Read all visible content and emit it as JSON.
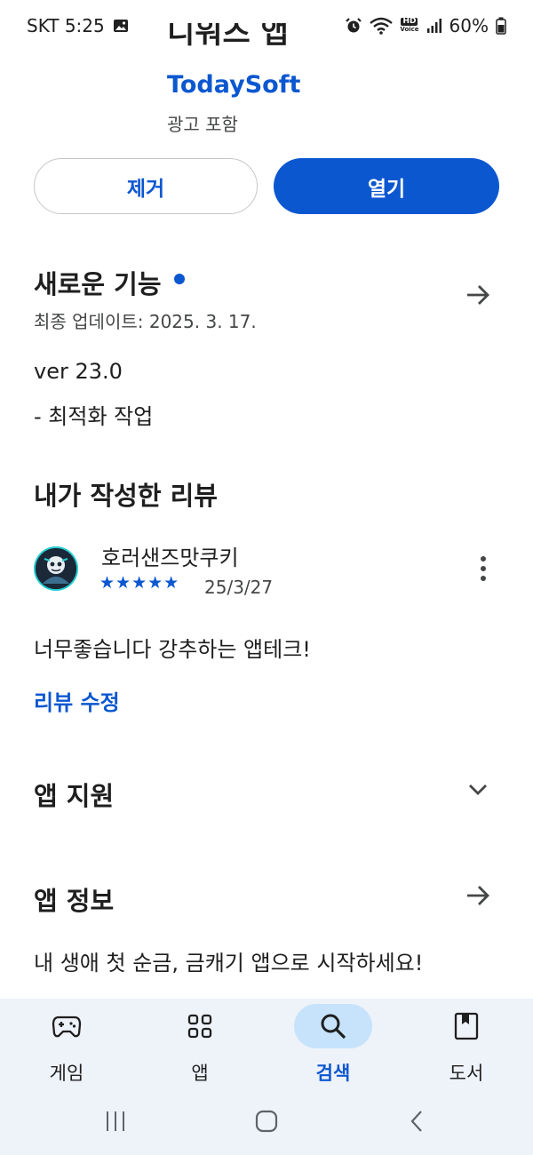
{
  "status_bar": {
    "carrier_time": "SKT 5:25",
    "battery": "60%",
    "hd_voice_top": "HD",
    "hd_voice_bottom": "Voice"
  },
  "app": {
    "title_partial": "디워즈 앱",
    "developer": "TodaySoft",
    "ad_label": "광고 포함"
  },
  "buttons": {
    "remove": "제거",
    "open": "열기"
  },
  "whats_new": {
    "title": "새로운 기능",
    "updated": "최종 업데이트: 2025. 3. 17.",
    "version": "ver 23.0",
    "notes": "- 최적화 작업"
  },
  "my_review": {
    "title": "내가 작성한 리뷰",
    "reviewer": "호러샌즈맛쿠키",
    "rating": 5,
    "stars": "★★★★★",
    "date": "25/3/27",
    "text": "너무좋습니다 강추하는 앱테크!",
    "edit_label": "리뷰 수정"
  },
  "app_support": {
    "title": "앱 지원"
  },
  "app_info": {
    "title": "앱 정보",
    "description": "내 생애 첫 순금, 금캐기 앱으로 시작하세요!"
  },
  "bottom_nav": {
    "items": [
      {
        "label": "게임",
        "icon": "gamepad-icon"
      },
      {
        "label": "앱",
        "icon": "apps-grid-icon"
      },
      {
        "label": "검색",
        "icon": "search-icon",
        "active": true
      },
      {
        "label": "도서",
        "icon": "book-icon"
      }
    ]
  },
  "colors": {
    "accent": "#0b57d0",
    "nav_background": "#eef2f9",
    "active_pill": "#c6e3fb"
  }
}
